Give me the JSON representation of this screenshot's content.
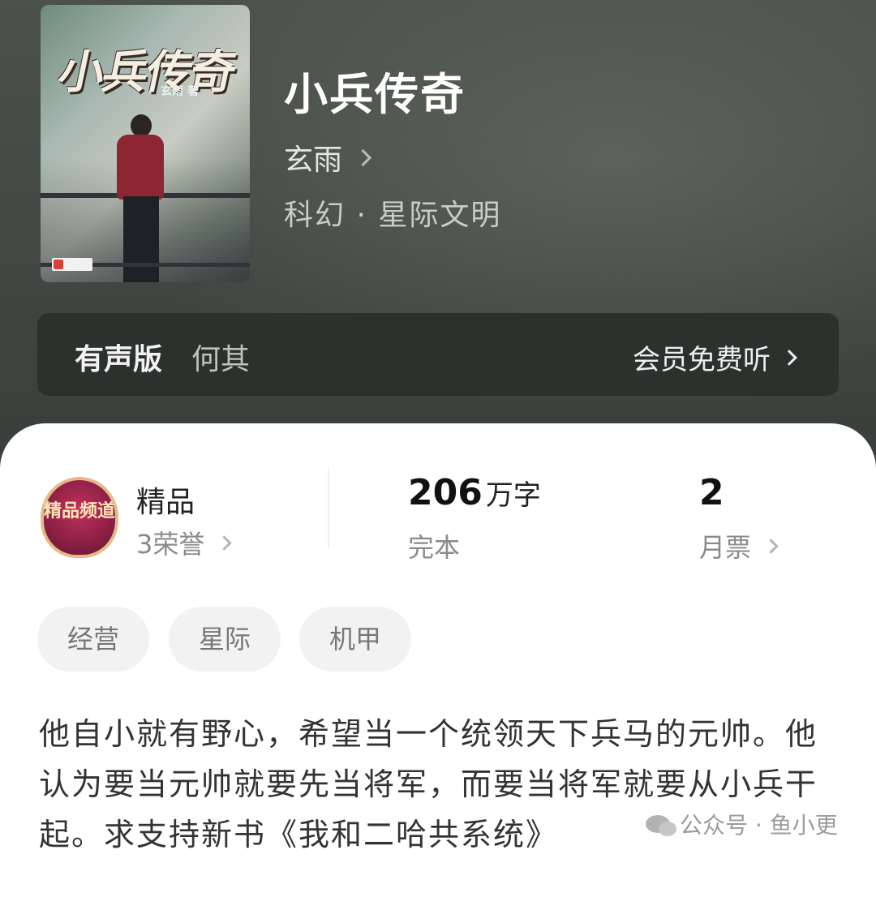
{
  "book": {
    "cover_title": "小兵传奇",
    "cover_author": "玄雨 著",
    "title": "小兵传奇",
    "author": "玄雨",
    "genre": "科幻 · 星际文明"
  },
  "audio": {
    "label": "有声版",
    "narrator": "何其",
    "cta": "会员免费听"
  },
  "stats": {
    "badge_text": "精品频道",
    "quality_title": "精品",
    "honors": "3荣誉",
    "word_count": "206",
    "word_unit": "万字",
    "status": "完本",
    "monthly_votes": "2",
    "monthly_label": "月票"
  },
  "tags": [
    "经营",
    "星际",
    "机甲"
  ],
  "description": "他自小就有野心，希望当一个统领天下兵马的元帅。他认为要当元帅就要先当将军，而要当将军就要从小兵干起。求支持新书《我和二哈共系统》",
  "watermark": "公众号 · 鱼小更",
  "colors": {
    "hero_bg": "#434944",
    "sheet_bg": "#ffffff",
    "tag_bg": "#f2f2f2",
    "badge": "#8a2045"
  }
}
